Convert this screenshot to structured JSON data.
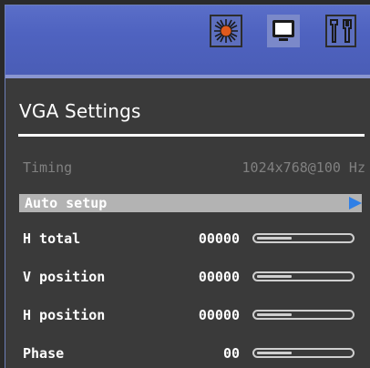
{
  "menu": {
    "tabs": [
      {
        "icon": "sun-brightness-icon",
        "active": false
      },
      {
        "icon": "monitor-icon",
        "active": true
      },
      {
        "icon": "tools-icon",
        "active": false
      }
    ],
    "title": "VGA Settings"
  },
  "items": {
    "timing": {
      "label": "Timing",
      "value": "1024x768@100 Hz"
    },
    "auto_setup": {
      "label": "Auto setup"
    },
    "h_total": {
      "label": "H total",
      "value": "00000",
      "level": 0.35
    },
    "v_position": {
      "label": "V position",
      "value": "00000",
      "level": 0.35
    },
    "h_position": {
      "label": "H position",
      "value": "00000",
      "level": 0.35
    },
    "phase": {
      "label": "Phase",
      "value": "00",
      "level": 0.35
    }
  },
  "colors": {
    "topbar": "#4f63c0",
    "background": "#3a3a3a",
    "highlight": "#b3b3b3",
    "arrow": "#2f7fe6",
    "disabled_text": "#808080"
  }
}
